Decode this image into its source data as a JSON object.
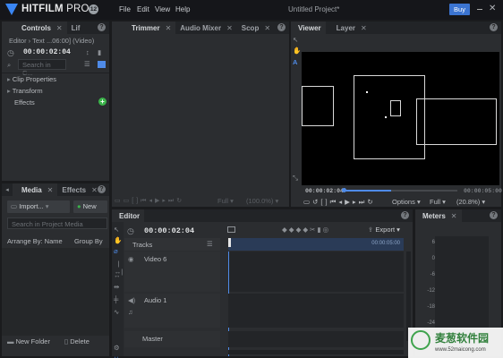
{
  "app": {
    "logo_name": "HITFILM",
    "logo_suffix": "PRO",
    "version": "12",
    "menu": [
      "File",
      "Edit",
      "View",
      "Help"
    ],
    "project_title": "Untitled Project*",
    "buy_label": "Buy",
    "close_glyph": "✕"
  },
  "controls": {
    "tabs": [
      "Controls",
      "Lif"
    ],
    "breadcrumb": "Editor › Text ...06:00] (Video)",
    "time": "00:00:02:04",
    "search_placeholder": "Search in C...",
    "properties": [
      "Clip Properties",
      "Transform",
      "Effects"
    ]
  },
  "media": {
    "tabs": [
      "Media",
      "Effects"
    ],
    "import_label": "Import...",
    "new_label": "New",
    "search_placeholder": "Search in Project Media",
    "arrange_label": "Arrange By: Name",
    "group_label": "Group By",
    "new_folder_label": "New Folder",
    "delete_label": "Delete"
  },
  "trimmer": {
    "tabs": [
      "Trimmer",
      "Audio Mixer",
      "Scop"
    ],
    "quality": "Full",
    "zoom": "(100.0%)"
  },
  "viewer": {
    "tabs": [
      "Viewer",
      "Layer"
    ],
    "time_start": "00:00:02:04",
    "time_end": "00:00:05:00",
    "options_label": "Options",
    "quality": "Full",
    "zoom": "(20.8%)"
  },
  "editor": {
    "tab": "Editor",
    "time": "00:00:02:04",
    "tracks_label": "Tracks",
    "export_label": "Export",
    "ruler_label": "00:00:05:00",
    "tracks": [
      "Video 6",
      "Audio 1",
      "Master"
    ]
  },
  "meters": {
    "tab": "Meters",
    "scale": [
      "6",
      "0",
      "-6",
      "-12",
      "-18",
      "-24"
    ]
  },
  "watermark": {
    "name": "麦葱软件园",
    "url": "www.52maicong.com"
  }
}
